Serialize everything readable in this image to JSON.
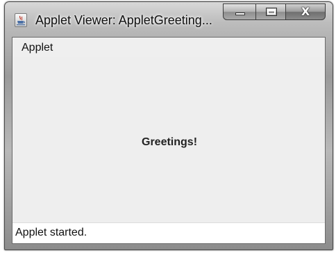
{
  "window": {
    "title": "Applet Viewer: AppletGreeting...",
    "icon": "java-icon",
    "controls": {
      "minimize": "minimize-icon",
      "maximize": "maximize-icon",
      "close": "close-icon",
      "close_glyph": "X"
    }
  },
  "menubar": {
    "applet_label": "Applet"
  },
  "canvas": {
    "greeting": "Greetings!"
  },
  "status": {
    "text": "Applet started."
  }
}
